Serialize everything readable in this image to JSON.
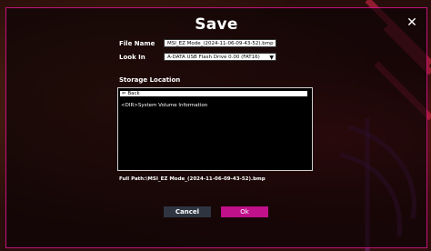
{
  "dialog": {
    "title": "Save",
    "close_glyph": "✕"
  },
  "form": {
    "file_name_label": "File Name",
    "file_name_value": "MSI_EZ Mode_(2024-11-06-09-43-52).bmp",
    "look_in_label": "Look In",
    "look_in_value": "A-DATA USB Flash Drive 0.00 (FAT16)",
    "storage_label": "Storage Location",
    "storage_items": [
      "⇐ Back",
      "<DIR>System Volume Information"
    ],
    "full_path": "Full Path:\\MSI_EZ Mode_(2024-11-06-09-43-52).bmp"
  },
  "buttons": {
    "cancel": "Cancel",
    "ok": "Ok"
  },
  "colors": {
    "accent": "#c0108a",
    "cancel_bg": "#2e3540"
  }
}
